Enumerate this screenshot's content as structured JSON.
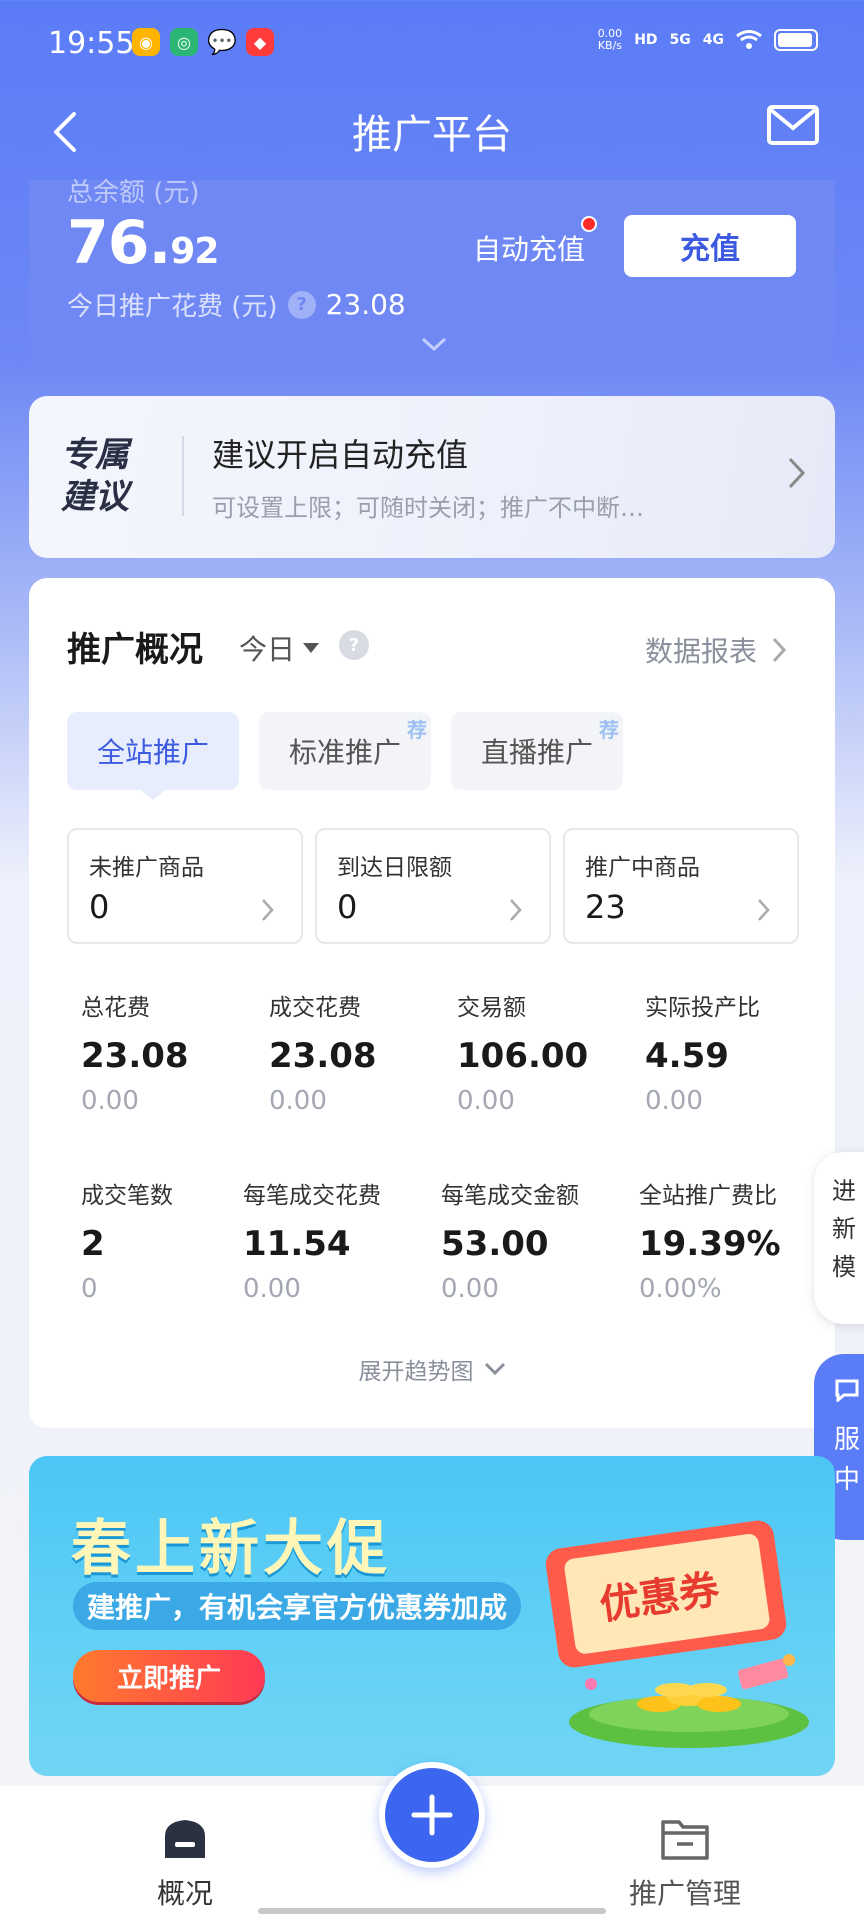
{
  "status_bar": {
    "time": "19:55",
    "net_speed": "0.00\nKB/s",
    "hd": "HD",
    "sig5g": "5G",
    "sig4g": "4G"
  },
  "nav": {
    "title": "推广平台"
  },
  "balance": {
    "label": "总余额 (元)",
    "amount_int": "76.",
    "amount_dec": "92",
    "today_label": "今日推广花费 (元)",
    "today_value": "23.08",
    "auto_recharge": "自动充值",
    "recharge_btn": "充值"
  },
  "suggest": {
    "badge_line1": "专属",
    "badge_line2": "建议",
    "title": "建议开启自动充值",
    "subtitle": "可设置上限；可随时关闭；推广不中断…"
  },
  "overview": {
    "title": "推广概况",
    "date": "今日",
    "report": "数据报表",
    "tabs": [
      {
        "label": "全站推广",
        "badge": ""
      },
      {
        "label": "标准推广",
        "badge": "荐"
      },
      {
        "label": "直播推广",
        "badge": "荐"
      }
    ],
    "boxes": [
      {
        "label": "未推广商品",
        "value": "0"
      },
      {
        "label": "到达日限额",
        "value": "0"
      },
      {
        "label": "推广中商品",
        "value": "23"
      }
    ],
    "metrics_row1": [
      {
        "label": "总花费",
        "value": "23.08",
        "prev": "0.00"
      },
      {
        "label": "成交花费",
        "value": "23.08",
        "prev": "0.00"
      },
      {
        "label": "交易额",
        "value": "106.00",
        "prev": "0.00"
      },
      {
        "label": "实际投产比",
        "value": "4.59",
        "prev": "0.00"
      }
    ],
    "metrics_row2": [
      {
        "label": "成交笔数",
        "value": "2",
        "prev": "0"
      },
      {
        "label": "每笔成交花费",
        "value": "11.54",
        "prev": "0.00"
      },
      {
        "label": "每笔成交金额",
        "value": "53.00",
        "prev": "0.00"
      },
      {
        "label": "全站推广费比",
        "value": "19.39%",
        "prev": "0.00%"
      }
    ],
    "expand_trend": "展开趋势图"
  },
  "promo": {
    "title": "春上新大促",
    "subtitle": "建推广，有机会享官方优惠券加成",
    "button": "立即推广",
    "coupon_text": "优惠券"
  },
  "side": {
    "float1": "进\n新\n模",
    "float2": "服\n中"
  },
  "tabbar": {
    "overview": "概况",
    "manage": "推广管理"
  },
  "colors": {
    "primary": "#5b7cf7",
    "accent": "#3d5be0"
  }
}
